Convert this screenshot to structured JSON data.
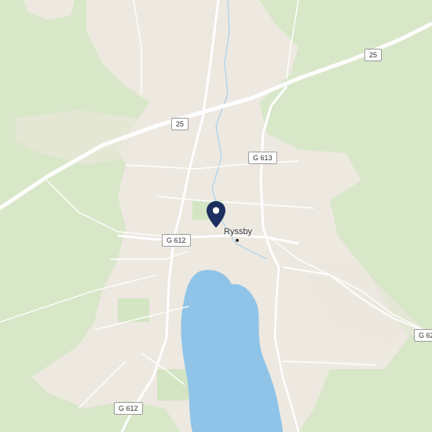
{
  "colors": {
    "forest": "#d6e6c8",
    "open_land": "#ede9e1",
    "water": "#8fc3e8",
    "road_major": "#ffffff",
    "pin": "#1d2f5e"
  },
  "roads": [
    {
      "ref": "25",
      "type": "national-road"
    },
    {
      "ref": "G 613",
      "type": "county-road"
    },
    {
      "ref": "G 612",
      "type": "county-road"
    },
    {
      "ref": "G 62",
      "type": "county-road"
    }
  ],
  "labels": {
    "r25_east": "25",
    "r25_west": "25",
    "g613": "G 613",
    "g612_north": "G 612",
    "g612_south": "G 612",
    "g62": "G 62"
  },
  "place": {
    "name": "Ryssby",
    "type": "locality"
  },
  "marker": {
    "icon": "location-pin-icon"
  }
}
